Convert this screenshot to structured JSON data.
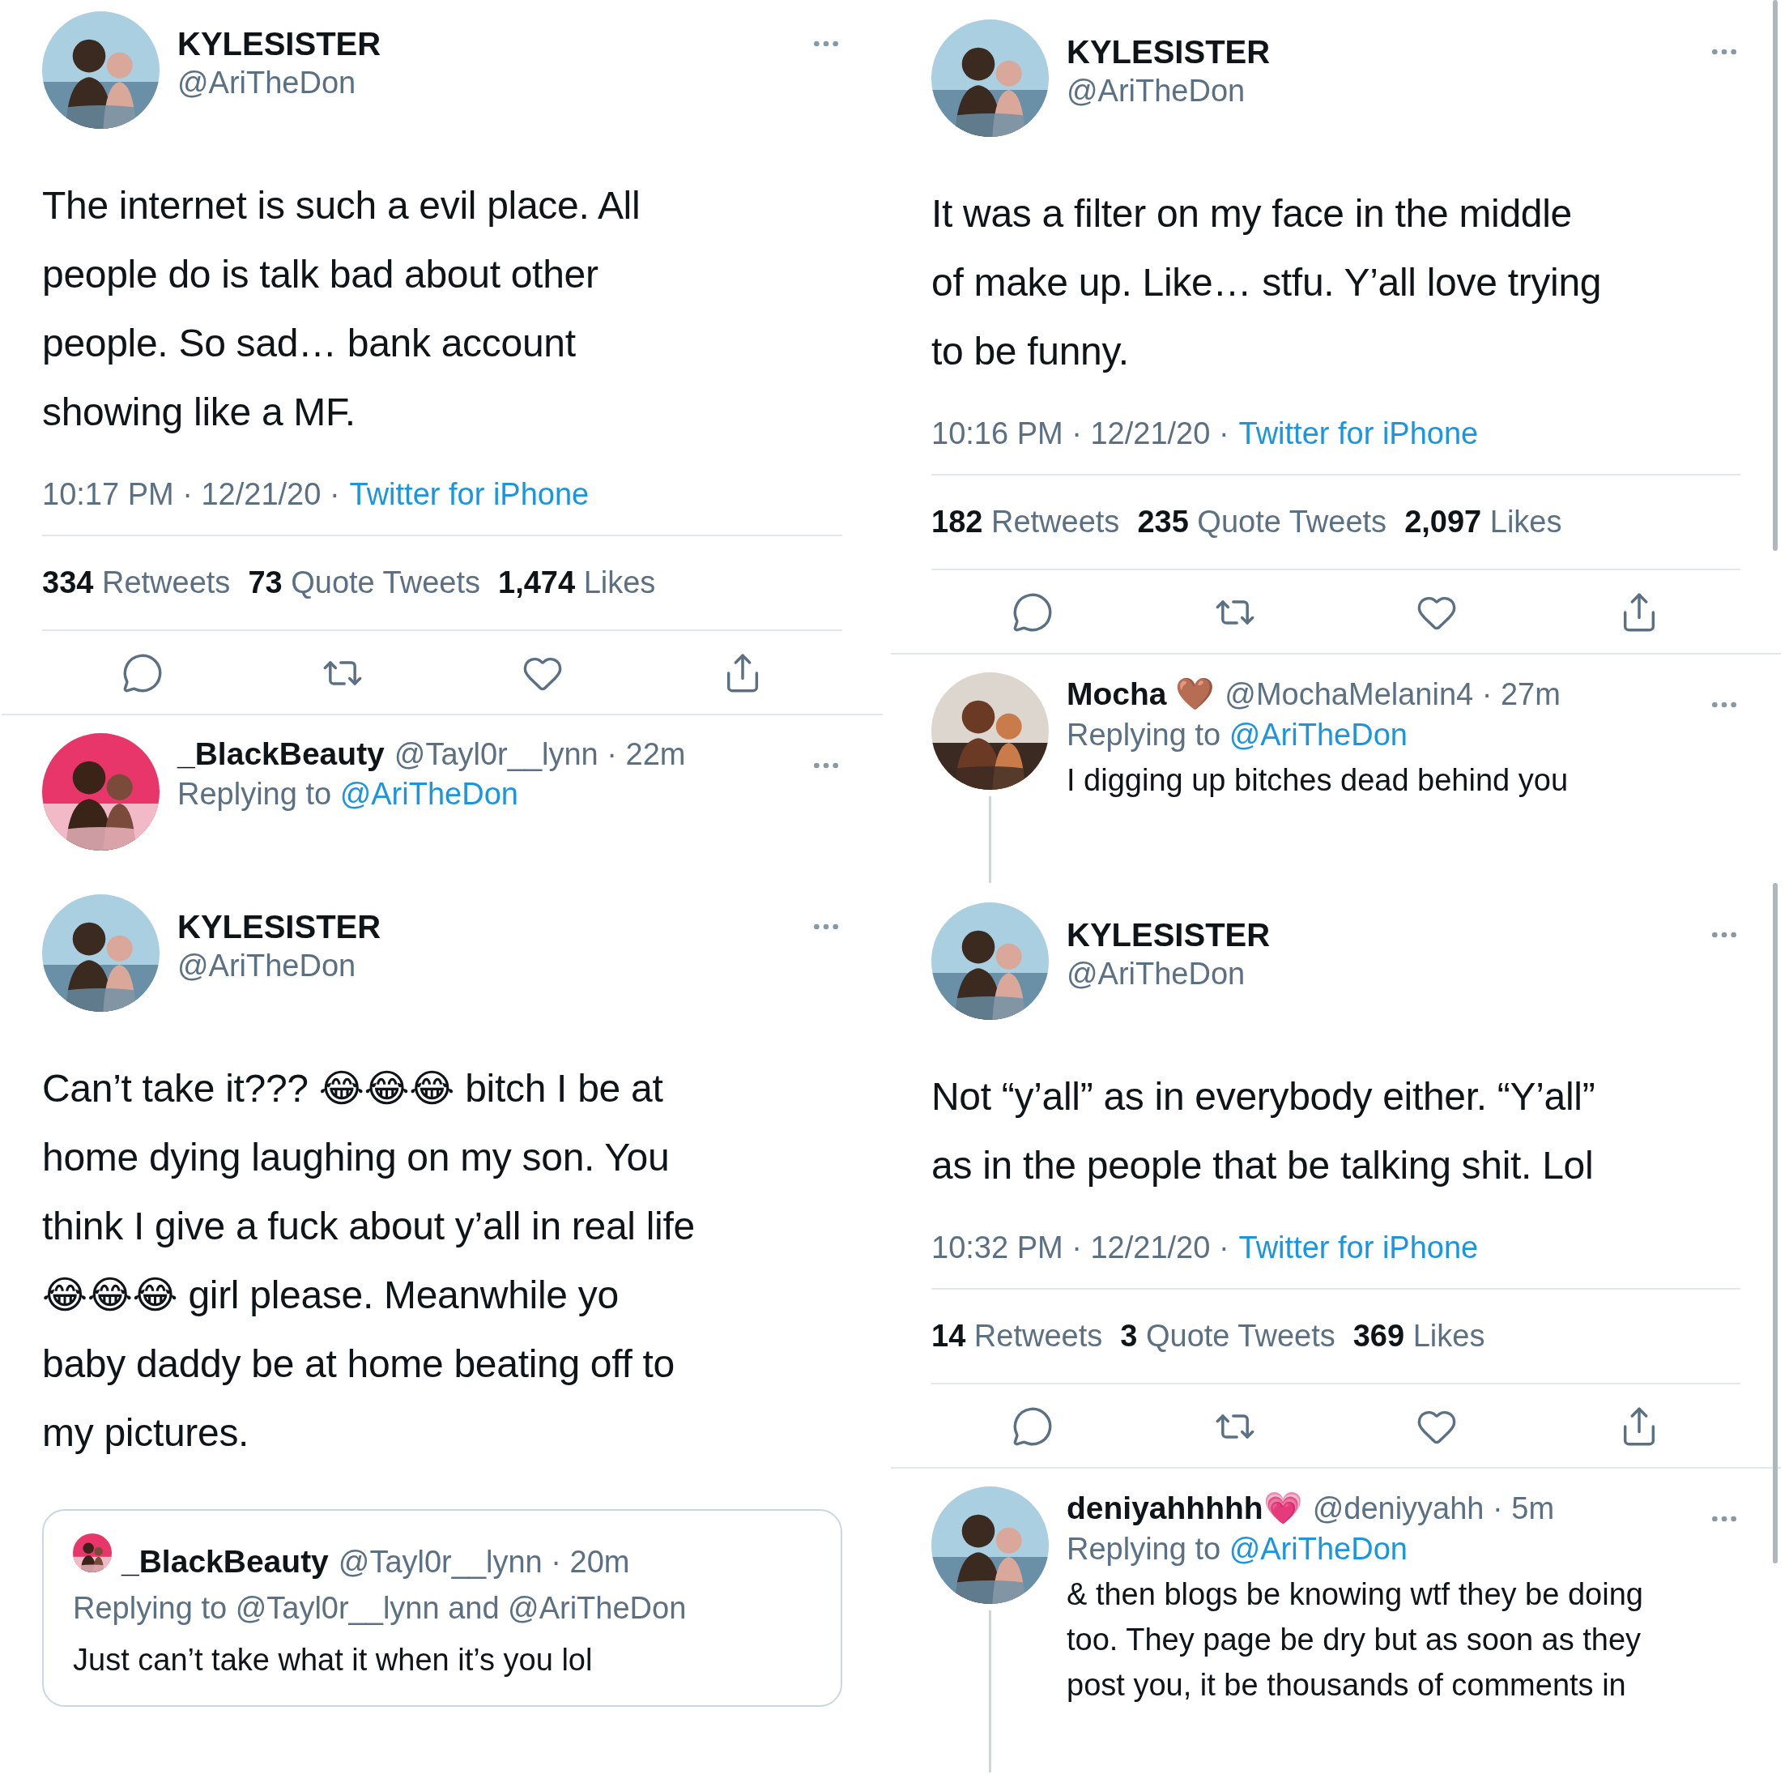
{
  "panels": [
    {
      "tweet": {
        "name": "KYLESISTER",
        "handle": "@AriTheDon",
        "text": "The internet is such a evil place. All\npeople do is talk bad about other\npeople. So sad… bank account\nshowing like a MF.",
        "timestamp": "10:17 PM · 12/21/20 ·",
        "source": "Twitter for iPhone",
        "stats": [
          {
            "count": "334",
            "label": "Retweets"
          },
          {
            "count": "73",
            "label": "Quote Tweets"
          },
          {
            "count": "1,474",
            "label": "Likes"
          }
        ]
      },
      "reply": {
        "name": "_BlackBeauty",
        "handle_line": "@Tayl0r__lynn · 22m",
        "replying_label": "Replying to",
        "mention": "@AriTheDon"
      }
    },
    {
      "tweet": {
        "name": "KYLESISTER",
        "handle": "@AriTheDon",
        "text": "It was a filter on my face in the middle\nof make up. Like… stfu. Y’all love trying\nto be funny.",
        "timestamp": "10:16 PM · 12/21/20 ·",
        "source": "Twitter for iPhone",
        "stats": [
          {
            "count": "182",
            "label": "Retweets"
          },
          {
            "count": "235",
            "label": "Quote Tweets"
          },
          {
            "count": "2,097",
            "label": "Likes"
          }
        ]
      },
      "reply": {
        "name": "Mocha 🤎",
        "handle_line": "@MochaMelanin4 · 27m",
        "replying_label": "Replying to",
        "mention": "@AriTheDon",
        "text": "I digging up bitches dead behind you"
      }
    },
    {
      "tweet": {
        "name": "KYLESISTER",
        "handle": "@AriTheDon",
        "text": "Can’t take it??? 😂😂😂 bitch I be at\nhome dying laughing on my son. You\nthink I give a fuck about y’all in real life\n😂😂😂 girl please. Meanwhile yo\nbaby daddy be at home beating off to\nmy pictures.",
        "quote": {
          "name": "_BlackBeauty",
          "handle_line": "@Tayl0r__lynn · 20m",
          "replying": "Replying to @Tayl0r__lynn and @AriTheDon",
          "text": "Just can’t take what it when it’s you lol"
        }
      }
    },
    {
      "tweet": {
        "name": "KYLESISTER",
        "handle": "@AriTheDon",
        "text": "Not “y’all” as in everybody either. “Y’all”\nas in the people that be talking shit. Lol",
        "timestamp": "10:32 PM · 12/21/20 ·",
        "source": "Twitter for iPhone",
        "stats": [
          {
            "count": "14",
            "label": "Retweets"
          },
          {
            "count": "3",
            "label": "Quote Tweets"
          },
          {
            "count": "369",
            "label": "Likes"
          }
        ]
      },
      "reply": {
        "name": "deniyahhhhh💗",
        "handle_line": "@deniyyahh · 5m",
        "replying_label": "Replying to",
        "mention": "@AriTheDon",
        "text": "& then blogs be knowing wtf they be doing\ntoo. They page be dry but as soon as they\npost you, it be thousands of comments in"
      }
    }
  ]
}
